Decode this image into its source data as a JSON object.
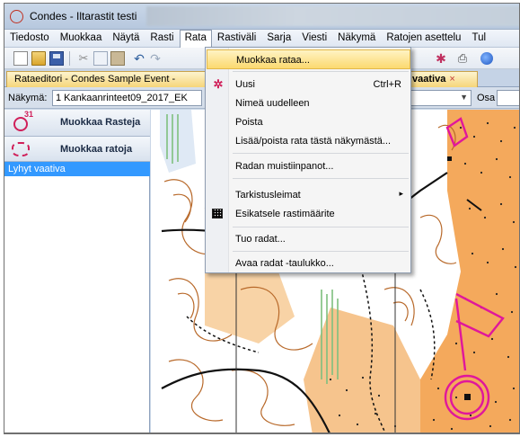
{
  "window": {
    "title": "Condes - Iltarastit testi"
  },
  "menubar": {
    "items": [
      "Tiedosto",
      "Muokkaa",
      "Näytä",
      "Rasti",
      "Rata",
      "Rastiväli",
      "Sarja",
      "Viesti",
      "Näkymä",
      "Ratojen asettelu",
      "Tul"
    ],
    "active": "Rata"
  },
  "tabs": [
    {
      "label": "Rataeditori - Condes Sample Event - ",
      "active": false
    },
    {
      "label": "vaativa",
      "active": true,
      "close": "×"
    }
  ],
  "viewbar": {
    "label": "Näkymä:",
    "value": "1 Kankaanrinteet09_2017_EK",
    "osa_label": "Osa"
  },
  "leftpanel": {
    "buttons": [
      {
        "label": "Muokkaa Rasteja",
        "icon": "control-circle-icon",
        "badge": "31"
      },
      {
        "label": "Muokkaa ratoja",
        "icon": "course-icon"
      }
    ],
    "courses": [
      "Lyhyt vaativa"
    ]
  },
  "dropdown": {
    "items": [
      {
        "label": "Muokkaa rataa...",
        "highlighted": true
      },
      {
        "label": "Uusi",
        "shortcut": "Ctrl+R",
        "icon": "new-course-icon"
      },
      {
        "label": "Nimeä uudelleen"
      },
      {
        "label": "Poista"
      },
      {
        "label": "Lisää/poista rata tästä näkymästä..."
      },
      {
        "label": "Radan muistiinpanot..."
      },
      {
        "label": "Tarkistusleimat",
        "submenu": "▸"
      },
      {
        "label": "Esikatsele rastimäärite",
        "icon": "description-grid-icon"
      },
      {
        "label": "Tuo radat..."
      },
      {
        "label": "Avaa radat -taulukko..."
      }
    ]
  },
  "colors": {
    "accent_highlight": "#fbd96f",
    "selection": "#3399ff",
    "course_magenta": "#e0179b",
    "map_orange": "#f4a95c"
  }
}
